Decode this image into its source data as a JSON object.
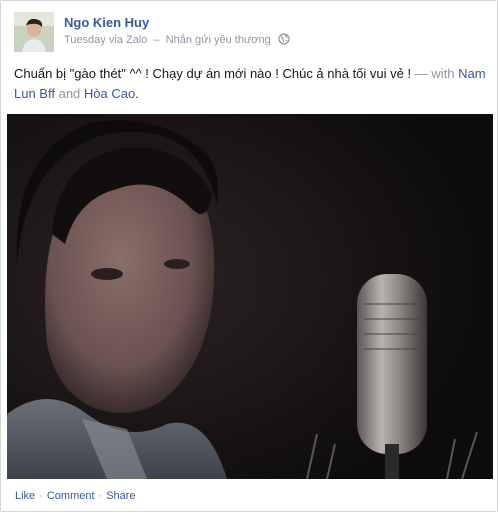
{
  "post": {
    "author": "Ngo Kien Huy",
    "time": "Tuesday",
    "via_prefix": "via",
    "app": "Zalo",
    "separator": "–",
    "feeling": "Nhắn gửi yêu thương",
    "privacy_icon": "globe-icon",
    "message": "Chuẩn bị \"gào thét\" ^^ ! Chạy dự án mới nào ! Chúc ả nhà tối vui vẻ !",
    "with_prefix": "— with",
    "tag1": "Nam Lun Bff",
    "and_word": "and",
    "tag2": "Hòa Cao",
    "end_punct": "."
  },
  "actions": {
    "like": "Like",
    "comment": "Comment",
    "share": "Share",
    "dot": "·"
  },
  "colors": {
    "link": "#3b5998",
    "muted": "#9197a3",
    "text": "#141823",
    "border": "#d3d6db"
  }
}
